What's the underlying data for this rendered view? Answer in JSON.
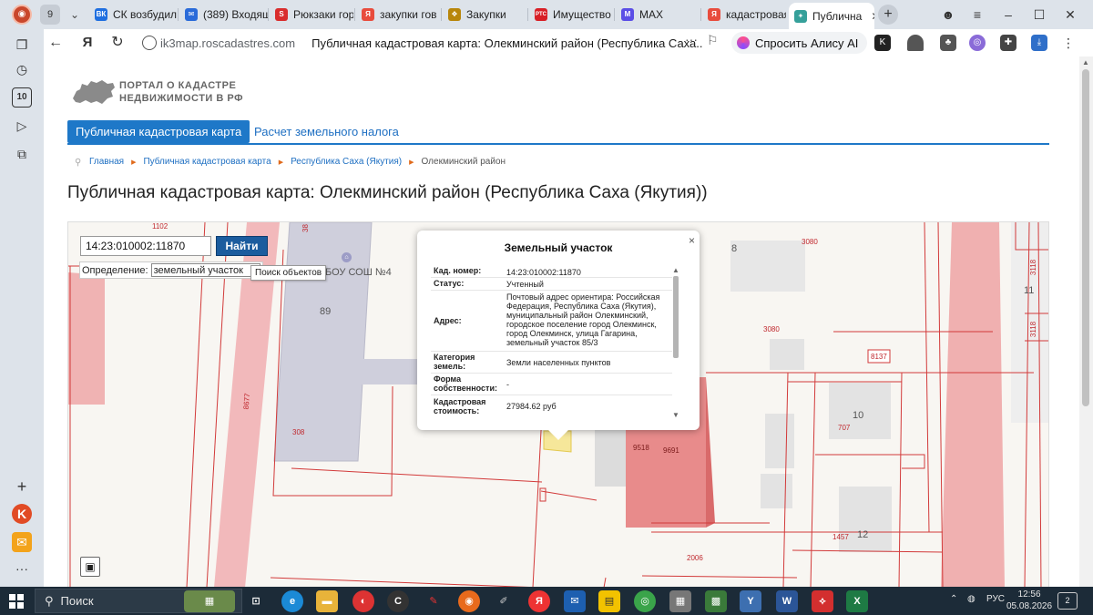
{
  "browser": {
    "tab_count": "9",
    "tabs": [
      {
        "label": "СК возбудил",
        "color": "#1f6fe0",
        "glyph": "ВК"
      },
      {
        "label": "(389) Входящ",
        "color": "#2a6bd9",
        "glyph": "✉"
      },
      {
        "label": "Рюкзаки гор",
        "color": "#d92d2d",
        "glyph": "S"
      },
      {
        "label": "закупки гов",
        "color": "#e84c3d",
        "glyph": "Я"
      },
      {
        "label": "Закупки",
        "color": "#b8860b",
        "glyph": "❖"
      },
      {
        "label": "Имущество",
        "color": "#d81f26",
        "glyph": "РТС"
      },
      {
        "label": "MAX",
        "color": "#5b4ee6",
        "glyph": "M"
      },
      {
        "label": "кадастровая",
        "color": "#e84c3d",
        "glyph": "Я"
      },
      {
        "label": "Публична",
        "color": "#35a09a",
        "glyph": "✦"
      }
    ],
    "url_host": "ik3map.roscadastres.com",
    "url_title": "Публичная кадастровая карта: Олекминский район (Республика Саха...",
    "alice_label": "Спросить Алису AI"
  },
  "site": {
    "logo_line1": "ПОРТАЛ О КАДАСТРЕ",
    "logo_line2": "НЕДВИЖИМОСТИ В РФ",
    "nav_active": "Публичная кадастровая карта",
    "nav_second": "Расчет земельного налога",
    "breadcrumbs": [
      "Главная",
      "Публичная кадастровая карта",
      "Республика Саха (Якутия)",
      "Олекминский район"
    ],
    "page_title": "Публичная кадастровая карта: Олекминский район (Республика Саха (Якутия))"
  },
  "map": {
    "search_value": "14:23:010002:11870",
    "search_button": "Найти",
    "def_label": "Определение:",
    "def_value": "земельный участок",
    "tooltip": "Поиск объектов",
    "labels": {
      "school": "БОУ СОШ №4",
      "b89": "89",
      "b8": "8",
      "b11": "11",
      "b10": "10",
      "b12": "12",
      "r3080a": "3080",
      "r3080b": "3080",
      "r3118a": "3118",
      "r3118b": "3118",
      "r8137": "8137",
      "r707": "707",
      "r9518": "9518",
      "r9691": "9691",
      "r1457": "1457",
      "r2006": "2006",
      "r308": "308",
      "r8677": "8677",
      "r1102": "1102",
      "r38": "38"
    }
  },
  "popup": {
    "title": "Земельный участок",
    "close": "×",
    "rows": [
      {
        "key": "Кад. номер:",
        "value": "14:23:010002:11870"
      },
      {
        "key": "Статус:",
        "value": "Учтенный"
      },
      {
        "key": "Адрес:",
        "value": "Почтовый адрес ориентира: Российская Федерация, Республика Саха (Якутия), муниципальный район Олекминский, городское поселение город Олекминск, город Олекминск, улица Гагарина, земельный участок 85/3"
      },
      {
        "key": "Категория земель:",
        "value": "Земли населенных пунктов"
      },
      {
        "key": "Форма собственности:",
        "value": "-"
      },
      {
        "key": "Кадастровая стоимость:",
        "value": "27984.62 руб"
      }
    ]
  },
  "taskbar": {
    "search_label": "Поиск",
    "lang": "РУС",
    "time": "12:56",
    "date": "05.08.2026",
    "notif_count": "2"
  }
}
